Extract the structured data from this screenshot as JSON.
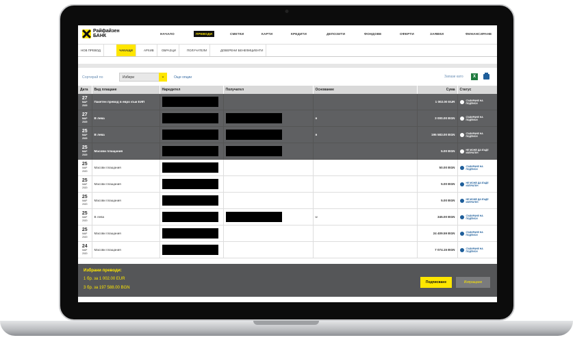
{
  "brand": {
    "name": "Райфайзен БАНК",
    "accent": "#fee600"
  },
  "nav": {
    "items": [
      {
        "label": "НАЧАЛО",
        "active": false
      },
      {
        "label": "ПРЕВОДИ",
        "active": true
      },
      {
        "label": "СМЕТКИ",
        "active": false
      },
      {
        "label": "КАРТИ",
        "active": false
      },
      {
        "label": "КРЕДИТИ",
        "active": false
      },
      {
        "label": "ДЕПОЗИТИ",
        "active": false
      },
      {
        "label": "ФОНДОВЕ",
        "active": false
      },
      {
        "label": "ОФЕРТИ",
        "active": false
      },
      {
        "label": "ЗАЯВКИ",
        "active": false
      },
      {
        "label": "ФИНАНСИРАНЕ",
        "active": false
      }
    ]
  },
  "subnav": {
    "items": [
      {
        "label": "НОВ ПРЕВОД",
        "active": false
      },
      {
        "label": "ЧАКАЩИ",
        "active": true
      },
      {
        "label": "АРХИВ",
        "active": false
      },
      {
        "label": "ОБРАЗЦИ",
        "active": false
      },
      {
        "label": "ПОЛУЧАТЕЛИ",
        "active": false
      },
      {
        "label": "ДОВЕРЕНИ БЕНЕФИЦИЕНТИ",
        "active": false
      }
    ]
  },
  "sort": {
    "label": "Сортирай по",
    "selected": "Избери",
    "more_options": "Още опции"
  },
  "save_as": "Запази като",
  "table": {
    "headers": {
      "date": "Дата",
      "type": "Вид плащане",
      "payer": "Наредител",
      "payee": "Получател",
      "reason": "Основание",
      "amount": "Сума",
      "status": "Статус"
    },
    "rows": [
      {
        "day": "27",
        "month": "МАР",
        "year": "2020",
        "type": "Пакетен превод в евро към ЕИП",
        "payee_redacted": false,
        "reason": "",
        "amount": "1 002.00 EUR",
        "status": "СЪБИРАНЕ НА ПОДПИСИ",
        "selected": true
      },
      {
        "day": "27",
        "month": "МАР",
        "year": "2020",
        "type": "В лева",
        "payee_redacted": true,
        "reason": "я",
        "amount": "3 000.00 BGN",
        "status": "СЪБИРАНЕ НА ПОДПИСИ",
        "selected": true
      },
      {
        "day": "25",
        "month": "МАР",
        "year": "2020",
        "type": "В лева",
        "payee_redacted": true,
        "reason": "я",
        "amount": "195 583.00 BGN",
        "status": "СЪБИРАНЕ НА ПОДПИСИ",
        "selected": true
      },
      {
        "day": "25",
        "month": "МАР",
        "year": "2020",
        "type": "Масови плащания",
        "payee_redacted": true,
        "reason": "",
        "amount": "5.00 BGN",
        "status": "НЕ МОЖЕ ДА БЪДЕ ИЗПРАТЕН",
        "selected": true
      },
      {
        "day": "25",
        "month": "МАР",
        "year": "2020",
        "type": "Масови плащания",
        "payee_redacted": false,
        "reason": "",
        "amount": "50.00 BGN",
        "status": "СЪБИРАНЕ НА ПОДПИСИ",
        "selected": false
      },
      {
        "day": "25",
        "month": "МАР",
        "year": "2020",
        "type": "Масови плащания",
        "payee_redacted": false,
        "reason": "",
        "amount": "5.00 BGN",
        "status": "НЕ МОЖЕ ДА БЪДЕ ИЗПРАТЕН",
        "selected": false
      },
      {
        "day": "25",
        "month": "МАР",
        "year": "2020",
        "type": "Масови плащания",
        "payee_redacted": false,
        "reason": "",
        "amount": "5.00 BGN",
        "status": "НЕ МОЖЕ ДА БЪДЕ ИЗПРАТЕН",
        "selected": false
      },
      {
        "day": "25",
        "month": "МАР",
        "year": "2020",
        "type": "В лева",
        "payee_redacted": true,
        "reason": "w",
        "amount": "345.00 BGN",
        "status": "СЪБИРАНЕ НА ПОДПИСИ",
        "selected": false
      },
      {
        "day": "25",
        "month": "МАР",
        "year": "2020",
        "type": "Масови плащания",
        "payee_redacted": false,
        "reason": "",
        "amount": "24 409.59 BGN",
        "status": "СЪБИРАНЕ НА ПОДПИСИ",
        "selected": false
      },
      {
        "day": "24",
        "month": "МАР",
        "year": "2020",
        "type": "Масови плащания",
        "payee_redacted": false,
        "reason": "",
        "amount": "7 074.15 BGN",
        "status": "СЪБИРАНЕ НА ПОДПИСИ",
        "selected": false
      }
    ]
  },
  "footer": {
    "title": "Избрани преводи:",
    "line1": "1 бр. за 1 002.00 EUR",
    "line2": "3 бр. за 197 588.00 BGN",
    "sign_button": "Подписване",
    "reject_button": "Изпращане"
  }
}
